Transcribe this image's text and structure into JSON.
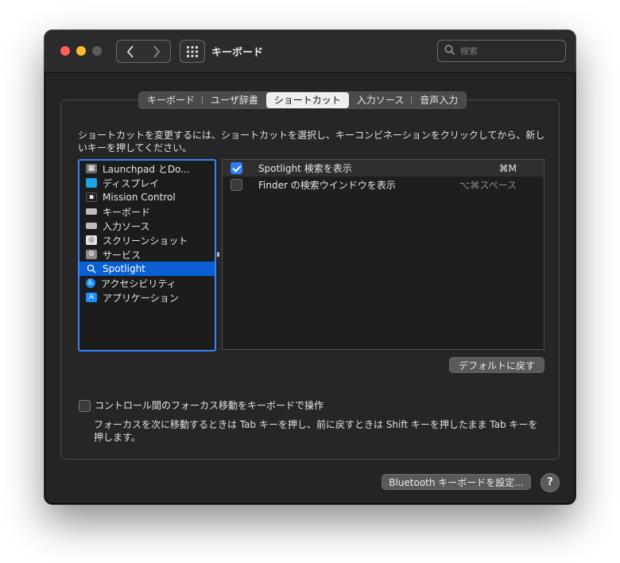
{
  "window": {
    "title": "キーボード"
  },
  "search": {
    "placeholder": "検索"
  },
  "tabs": [
    {
      "label": "キーボード"
    },
    {
      "label": "ユーザ辞書"
    },
    {
      "label": "ショートカット",
      "active": true
    },
    {
      "label": "入力ソース"
    },
    {
      "label": "音声入力"
    }
  ],
  "description": "ショートカットを変更するには、ショートカットを選択し、キーコンビネーションをクリックしてから、新しいキーを押してください。",
  "categories": [
    {
      "label": "Launchpad とDo...",
      "icon": "launchpad-icon",
      "color": "#7a7a7a"
    },
    {
      "label": "ディスプレイ",
      "icon": "display-icon",
      "color": "#1fa2e8"
    },
    {
      "label": "Mission Control",
      "icon": "mission-control-icon",
      "color": "#333333"
    },
    {
      "label": "キーボード",
      "icon": "keyboard-icon",
      "color": "#bdbdbd"
    },
    {
      "label": "入力ソース",
      "icon": "input-sources-icon",
      "color": "#bdbdbd"
    },
    {
      "label": "スクリーンショット",
      "icon": "screenshot-icon",
      "color": "#dddddd"
    },
    {
      "label": "サービス",
      "icon": "services-icon",
      "color": "#8a8a8a"
    },
    {
      "label": "Spotlight",
      "icon": "spotlight-icon",
      "color": "#0a5fd3",
      "selected": true
    },
    {
      "label": "アクセシビリティ",
      "icon": "accessibility-icon",
      "color": "#1a8cff"
    },
    {
      "label": "アプリケーション",
      "icon": "app-store-icon",
      "color": "#1a8cff"
    }
  ],
  "shortcuts": [
    {
      "label": "Spotlight 検索を表示",
      "key": "⌘M",
      "checked": true
    },
    {
      "label": "Finder の検索ウインドウを表示",
      "key": "⌥⌘スペース",
      "checked": false
    }
  ],
  "defaults_button": "デフォルトに戻す",
  "keyboard_nav": {
    "label": "コントロール間のフォーカス移動をキーボードで操作",
    "checked": false,
    "description": "フォーカスを次に移動するときは Tab キーを押し、前に戻すときは Shift キーを押したまま Tab キーを押します。"
  },
  "bluetooth_button": "Bluetooth キーボードを設定...",
  "help_label": "?"
}
